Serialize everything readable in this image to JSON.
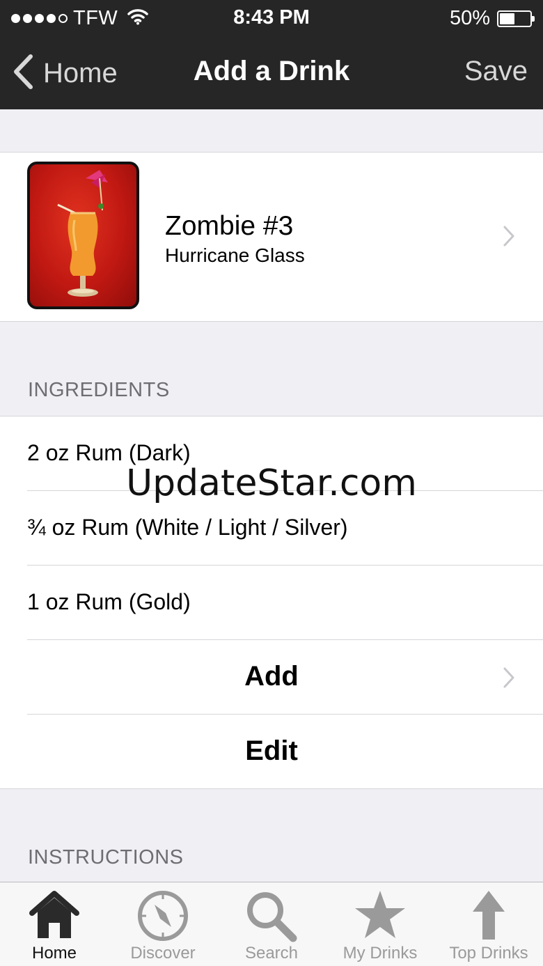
{
  "status_bar": {
    "carrier": "TFW",
    "time": "8:43 PM",
    "battery_percent": "50%",
    "battery_level": 0.5,
    "signal_bars_filled": 4,
    "signal_bars_total": 5
  },
  "nav": {
    "back_label": "Home",
    "title": "Add a Drink",
    "save_label": "Save"
  },
  "drink": {
    "name": "Zombie #3",
    "glass": "Hurricane Glass",
    "image_icon": "cocktail-photo"
  },
  "ingredients": {
    "header": "INGREDIENTS",
    "items": [
      "2 oz Rum (Dark)",
      "¾ oz Rum (White / Light / Silver)",
      "1 oz Rum (Gold)"
    ],
    "add_label": "Add",
    "edit_label": "Edit"
  },
  "instructions": {
    "header": "INSTRUCTIONS"
  },
  "watermark": "UpdateStar.com",
  "tabbar": {
    "items": [
      {
        "label": "Home",
        "icon": "house-icon",
        "active": true
      },
      {
        "label": "Discover",
        "icon": "compass-icon",
        "active": false
      },
      {
        "label": "Search",
        "icon": "magnifier-icon",
        "active": false
      },
      {
        "label": "My Drinks",
        "icon": "star-icon",
        "active": false
      },
      {
        "label": "Top Drinks",
        "icon": "up-arrow-icon",
        "active": false
      }
    ]
  },
  "colors": {
    "nav_background": "#262626",
    "page_background": "#efeff4",
    "inactive_tab": "#9a9a9a"
  }
}
